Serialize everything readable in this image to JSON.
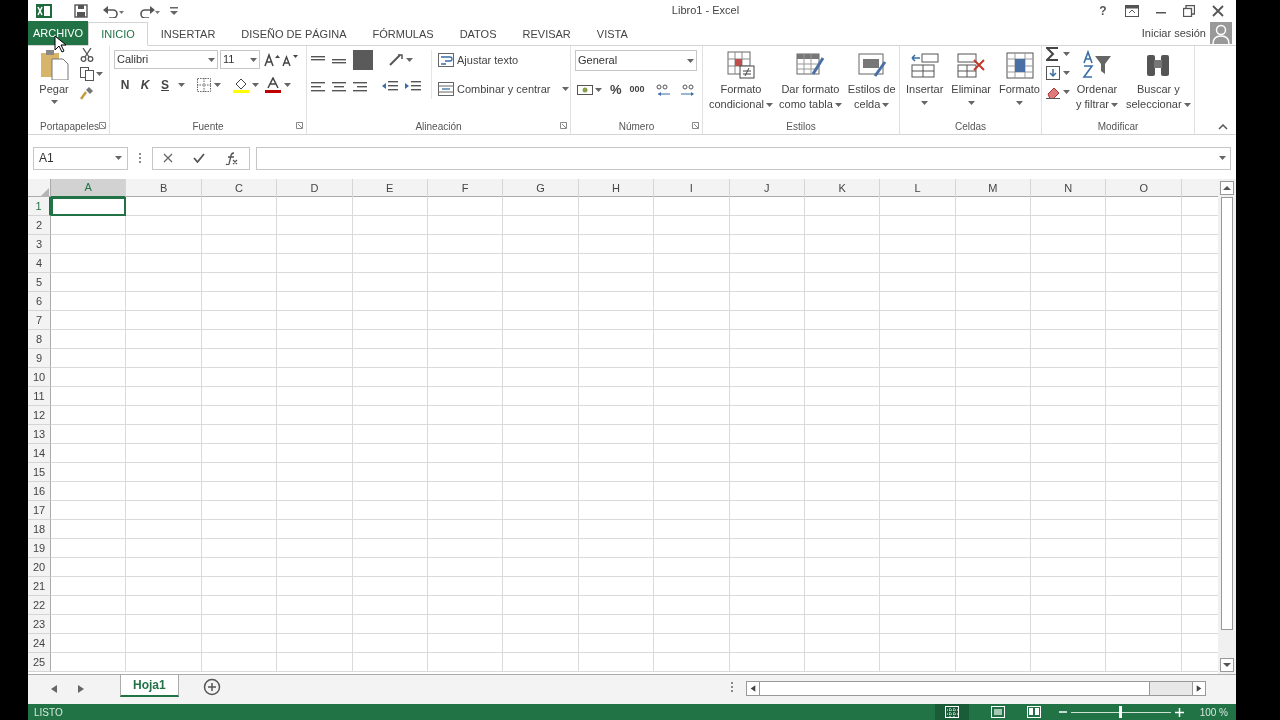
{
  "window": {
    "title": "Libro1 - Excel",
    "help": "?"
  },
  "tabs": [
    {
      "label": "ARCHIVO",
      "kind": "file",
      "selected": false
    },
    {
      "label": "INICIO",
      "kind": "tab",
      "selected": true
    },
    {
      "label": "INSERTAR",
      "kind": "tab",
      "selected": false
    },
    {
      "label": "DISEÑO DE PÁGINA",
      "kind": "tab",
      "selected": false
    },
    {
      "label": "FÓRMULAS",
      "kind": "tab",
      "selected": false
    },
    {
      "label": "DATOS",
      "kind": "tab",
      "selected": false
    },
    {
      "label": "REVISAR",
      "kind": "tab",
      "selected": false
    },
    {
      "label": "VISTA",
      "kind": "tab",
      "selected": false
    }
  ],
  "sign_in": "Iniciar sesión",
  "ribbon": {
    "groups": [
      {
        "name": "Portapapeles",
        "launcher": true,
        "paste": "Pegar"
      },
      {
        "name": "Fuente",
        "launcher": true,
        "font": "Calibri",
        "size": "11",
        "styles": [
          "N",
          "K",
          "S"
        ]
      },
      {
        "name": "Alineación",
        "launcher": true,
        "buttons": [
          "Ajustar texto",
          "Combinar y centrar"
        ]
      },
      {
        "name": "Número",
        "launcher": true,
        "format": "General",
        "symbols": [
          "%",
          "000"
        ]
      },
      {
        "name": "Estilos",
        "launcher": false,
        "buttons": [
          {
            "lines": [
              "Formato",
              "condicional"
            ]
          },
          {
            "lines": [
              "Dar formato",
              "como tabla"
            ]
          },
          {
            "lines": [
              "Estilos de",
              "celda"
            ]
          }
        ]
      },
      {
        "name": "Celdas",
        "launcher": false,
        "buttons": [
          {
            "lines": [
              "Insertar"
            ]
          },
          {
            "lines": [
              "Eliminar"
            ]
          },
          {
            "lines": [
              "Formato"
            ]
          }
        ]
      },
      {
        "name": "Modificar",
        "launcher": false,
        "buttons": [
          {
            "lines": [
              "Ordenar",
              "y filtrar"
            ]
          },
          {
            "lines": [
              "Buscar y",
              "seleccionar"
            ]
          }
        ]
      }
    ]
  },
  "formula_bar": {
    "name_box": "A1"
  },
  "sheet": {
    "columns": [
      {
        "label": "A",
        "selected": true
      },
      {
        "label": "B",
        "selected": false
      },
      {
        "label": "C",
        "selected": false
      },
      {
        "label": "D",
        "selected": false
      },
      {
        "label": "E",
        "selected": false
      },
      {
        "label": "F",
        "selected": false
      },
      {
        "label": "G",
        "selected": false
      },
      {
        "label": "H",
        "selected": false
      },
      {
        "label": "I",
        "selected": false
      },
      {
        "label": "J",
        "selected": false
      },
      {
        "label": "K",
        "selected": false
      },
      {
        "label": "L",
        "selected": false
      },
      {
        "label": "M",
        "selected": false
      },
      {
        "label": "N",
        "selected": false
      },
      {
        "label": "O",
        "selected": false
      }
    ],
    "rows": [
      {
        "label": "1",
        "selected": true
      },
      {
        "label": "2",
        "selected": false
      },
      {
        "label": "3",
        "selected": false
      },
      {
        "label": "4",
        "selected": false
      },
      {
        "label": "5",
        "selected": false
      },
      {
        "label": "6",
        "selected": false
      },
      {
        "label": "7",
        "selected": false
      },
      {
        "label": "8",
        "selected": false
      },
      {
        "label": "9",
        "selected": false
      },
      {
        "label": "10",
        "selected": false
      },
      {
        "label": "11",
        "selected": false
      },
      {
        "label": "12",
        "selected": false
      },
      {
        "label": "13",
        "selected": false
      },
      {
        "label": "14",
        "selected": false
      },
      {
        "label": "15",
        "selected": false
      },
      {
        "label": "16",
        "selected": false
      },
      {
        "label": "17",
        "selected": false
      },
      {
        "label": "18",
        "selected": false
      },
      {
        "label": "19",
        "selected": false
      },
      {
        "label": "20",
        "selected": false
      },
      {
        "label": "21",
        "selected": false
      },
      {
        "label": "22",
        "selected": false
      },
      {
        "label": "23",
        "selected": false
      },
      {
        "label": "24",
        "selected": false
      },
      {
        "label": "25",
        "selected": false
      }
    ]
  },
  "sheet_tabs": [
    {
      "label": "Hoja1",
      "selected": true
    }
  ],
  "status_bar": {
    "status": "LISTO",
    "zoom": "100 %",
    "zoom_level": {
      "level": 0.5
    }
  }
}
